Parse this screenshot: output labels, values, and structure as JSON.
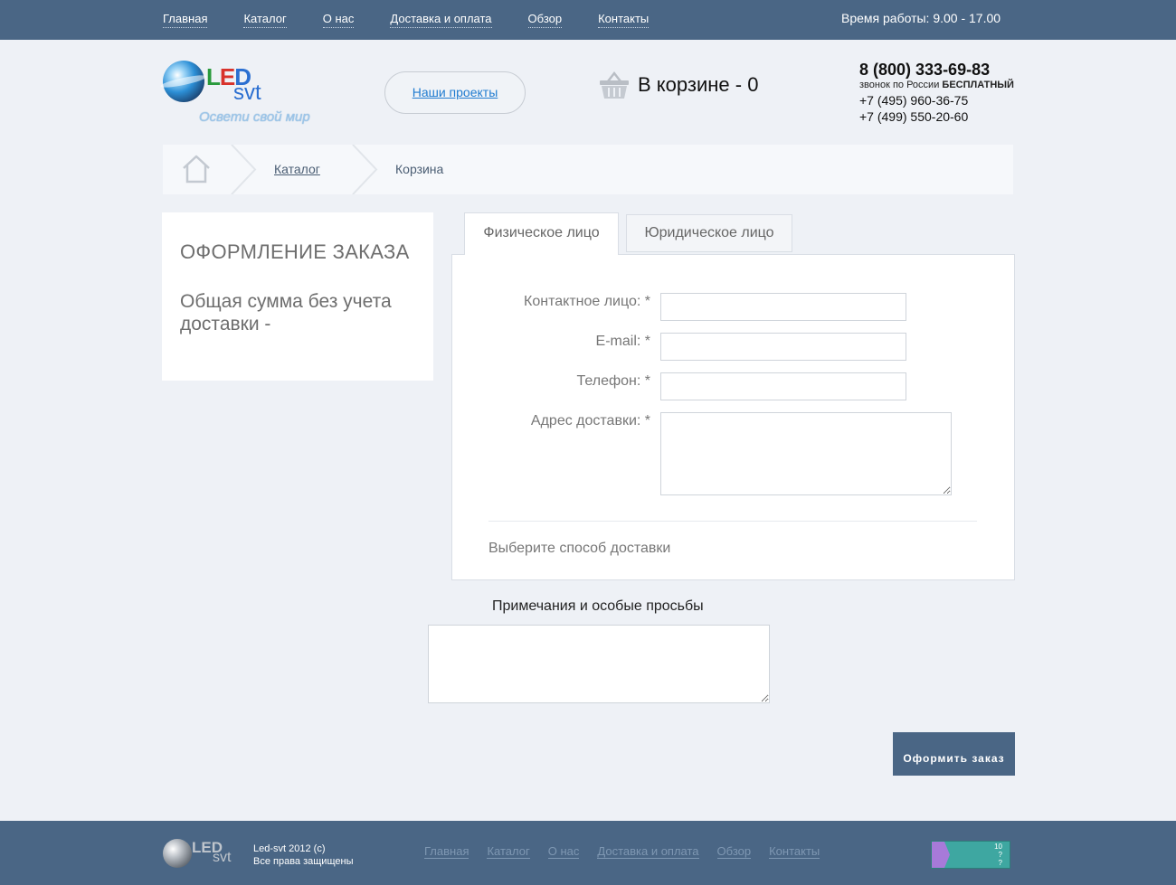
{
  "topnav": {
    "items": [
      "Главная",
      "Каталог",
      "О нас",
      "Доставка и оплата",
      "Обзор",
      "Контакты"
    ],
    "worktime": "Время работы: 9.00 - 17.00"
  },
  "header": {
    "logo": {
      "led": [
        "L",
        "E",
        "D"
      ],
      "svt": "svt",
      "slogan": "Освети свой мир"
    },
    "projects_label": "Наши проекты",
    "cart_label": "В корзине - 0",
    "phone_main": "8 (800) 333-69-83",
    "phone_note_pre": "звонок по России",
    "phone_note_bold": "БЕСПЛАТНЫЙ",
    "phone_2": "+7 (495) 960-36-75",
    "phone_3": "+7 (499) 550-20-60"
  },
  "breadcrumb": {
    "items": [
      "Каталог",
      "Корзина"
    ]
  },
  "left": {
    "title": "ОФОРМЛЕНИЕ ЗАКАЗА",
    "sum": "Общая сумма без учета доставки -"
  },
  "tabs": [
    "Физическое лицо",
    "Юридическое лицо"
  ],
  "form": {
    "contact_label": "Контактное лицо: *",
    "email_label": "E-mail: *",
    "phone_label": "Телефон: *",
    "address_label": "Адрес доставки: *",
    "contact_value": "",
    "email_value": "",
    "phone_value": "",
    "address_value": "",
    "delivery_label": "Выберите способ доставки"
  },
  "notes": {
    "label": "Примечания и особые просьбы",
    "value": ""
  },
  "submit_label": "Оформить заказ",
  "footer": {
    "logo_led": "LED",
    "logo_svt": "svt",
    "copyright_1": "Led-svt 2012 (c)",
    "copyright_2": "Все права защищены",
    "nav": [
      "Главная",
      "Каталог",
      "О нас",
      "Доставка и оплата",
      "Обзор",
      "Контакты"
    ],
    "counter": [
      "10",
      "?",
      "?"
    ]
  },
  "colors": {
    "brand": "#4a6685",
    "link": "#1f7bd0",
    "footer_link": "#7e97b2",
    "counter": "#3ea7a1"
  }
}
